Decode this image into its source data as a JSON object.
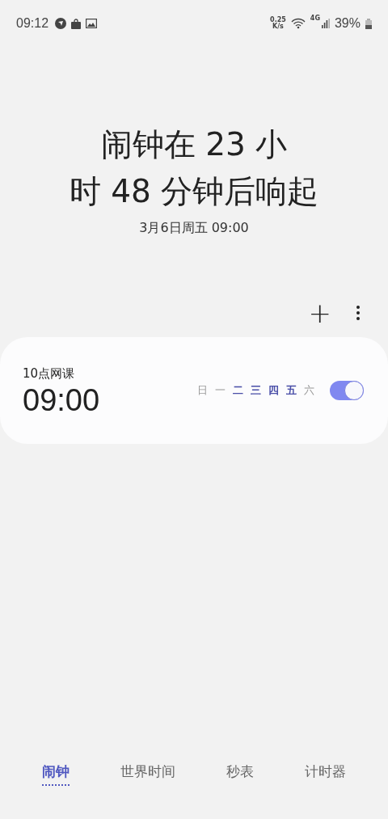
{
  "status_bar": {
    "time": "09:12",
    "net_speed_value": "0.25",
    "net_speed_unit": "K/s",
    "network": "4G",
    "battery": "39%"
  },
  "next_alarm": {
    "title_lines": [
      "闹钟在 23 小",
      "时 48 分钟后响起"
    ],
    "date": "3月6日周五 09:00"
  },
  "toolbar": {
    "add": "+"
  },
  "alarms": [
    {
      "label": "10点网课",
      "time": "09:00",
      "on": true,
      "days": [
        {
          "label": "日",
          "selected": false
        },
        {
          "label": "一",
          "selected": false
        },
        {
          "label": "二",
          "selected": true
        },
        {
          "label": "三",
          "selected": true
        },
        {
          "label": "四",
          "selected": true
        },
        {
          "label": "五",
          "selected": true
        },
        {
          "label": "六",
          "selected": false
        }
      ]
    }
  ],
  "tabs": [
    {
      "label": "闹钟",
      "selected": true
    },
    {
      "label": "世界时间",
      "selected": false
    },
    {
      "label": "秒表",
      "selected": false
    },
    {
      "label": "计时器",
      "selected": false
    }
  ]
}
